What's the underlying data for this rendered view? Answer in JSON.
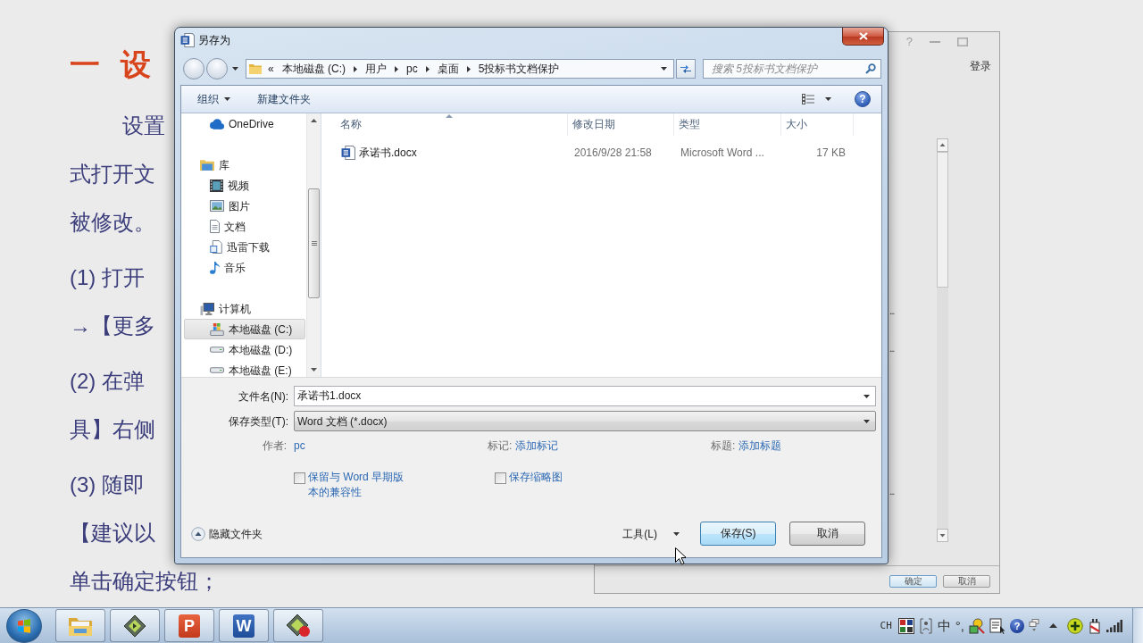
{
  "document": {
    "heading": "一 设",
    "paragraphs": [
      {
        "kind": "body",
        "lines": [
          "设置",
          "式打开文",
          "被修改。"
        ]
      },
      {
        "kind": "step",
        "lines": [
          "(1) 打开",
          "→【更多"
        ]
      },
      {
        "kind": "step",
        "lines": [
          "(2) 在弹",
          "具】右侧"
        ]
      },
      {
        "kind": "step",
        "lines": [
          "(3) 随即",
          "【建议以",
          "单击确定按钮；"
        ]
      }
    ]
  },
  "background_window": {
    "help": "?",
    "login": "登录",
    "row_endings": [
      "...",
      "...",
      "..."
    ],
    "buttons": [
      "确定",
      "取消"
    ]
  },
  "dialog": {
    "title": "另存为",
    "address": {
      "overflow": "«",
      "crumbs": [
        "本地磁盘 (C:)",
        "用户",
        "pc",
        "桌面",
        "5投标书文档保护"
      ]
    },
    "search": {
      "placeholder": "搜索 5投标书文档保护"
    },
    "toolbar": {
      "organize": "组织",
      "new_folder": "新建文件夹",
      "help": "?"
    },
    "nav": [
      {
        "children": [
          {
            "label": "OneDrive",
            "kind": "cloud",
            "selected": false
          }
        ]
      },
      {
        "label": "库",
        "kind": "library",
        "selected": false,
        "children": [
          {
            "label": "视频",
            "kind": "video",
            "selected": false
          },
          {
            "label": "图片",
            "kind": "pictures",
            "selected": false
          },
          {
            "label": "文档",
            "kind": "documents",
            "selected": false
          },
          {
            "label": "迅雷下载",
            "kind": "downloads",
            "selected": false
          },
          {
            "label": "音乐",
            "kind": "music",
            "selected": false
          }
        ]
      },
      {
        "label": "计算机",
        "kind": "computer",
        "selected": false,
        "children": [
          {
            "label": "本地磁盘 (C:)",
            "kind": "system-disk",
            "selected": true
          },
          {
            "label": "本地磁盘 (D:)",
            "kind": "disk",
            "selected": false
          },
          {
            "label": "本地磁盘 (E:)",
            "kind": "disk",
            "selected": false
          }
        ]
      }
    ],
    "files": {
      "columns": [
        {
          "label": "名称",
          "sorted": true
        },
        {
          "label": "修改日期",
          "sorted": false
        },
        {
          "label": "类型",
          "sorted": false
        },
        {
          "label": "大小",
          "sorted": false
        }
      ],
      "rows": [
        {
          "name": "承诺书.docx",
          "date": "2016/9/28 21:58",
          "type": "Microsoft Word ...",
          "size": "17 KB",
          "selected": false
        }
      ]
    },
    "form": {
      "filename": {
        "label": "文件名(N):",
        "value": "承诺书1.docx"
      },
      "filetype": {
        "label": "保存类型(T):",
        "value": "Word 文档 (*.docx)"
      },
      "properties": [
        {
          "label": "作者:",
          "value": "pc"
        },
        {
          "label": "标记:",
          "value": "添加标记"
        },
        {
          "label": "标题:",
          "value": "添加标题"
        }
      ],
      "checks": [
        {
          "label": "保留与 Word 早期版本的兼容性",
          "checked": false
        },
        {
          "label": "保存缩略图",
          "checked": false
        }
      ]
    },
    "footer": {
      "hide_folders": "隐藏文件夹",
      "tools": "工具(L)",
      "buttons": [
        {
          "label": "保存(S)",
          "default": true
        },
        {
          "label": "取消",
          "default": false
        }
      ]
    }
  },
  "taskbar": {
    "apps": [
      {
        "kind": "explorer"
      },
      {
        "kind": "green-app"
      },
      {
        "kind": "presentation",
        "glyph": "P"
      },
      {
        "kind": "word",
        "glyph": "W"
      },
      {
        "kind": "alert-app"
      }
    ],
    "tray": {
      "language": "CH",
      "ime_mode": "中",
      "punctuation": "°,",
      "help": "?"
    }
  }
}
